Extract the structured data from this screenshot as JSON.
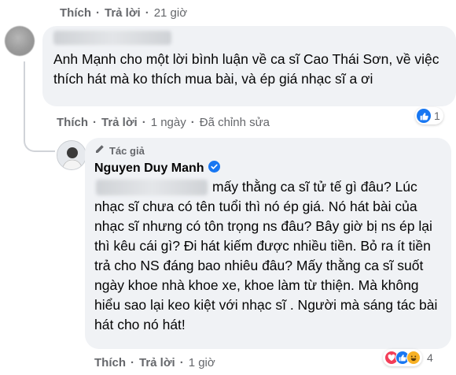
{
  "top_actions": {
    "like": "Thích",
    "reply": "Trả lời",
    "time": "21 giờ"
  },
  "comment_1": {
    "text": "Anh Mạnh cho một lời bình luận về ca sĩ Cao Thái Sơn, về việc thích hát mà ko thích mua bài, và ép giá nhạc sĩ a ơi",
    "actions": {
      "like": "Thích",
      "reply": "Trả lời",
      "time": "1 ngày",
      "edited": "Đã chỉnh sửa"
    },
    "reactions": {
      "icons": [
        "like-icon"
      ],
      "count": "1"
    }
  },
  "reply_1": {
    "author_badge": "Tác giả",
    "author_name": "Nguyen Duy Manh",
    "text": "mấy thằng ca sĩ tử tế gì đâu? Lúc nhạc sĩ chưa có tên tuổi thì nó ép giá. Nó hát bài của nhạc sĩ nhưng có tôn trọng ns đâu? Bây giờ bị ns ép lại thì kêu cái gì? Đi hát kiếm được nhiều tiền. Bỏ ra ít tiền trả cho NS đáng bao nhiêu đâu? Mấy thằng ca sĩ suốt ngày khoe nhà khoe xe, khoe làm từ thiện. Mà không hiểu sao lại keo kiệt với nhạc sĩ . Người mà sáng tác bài hát cho nó hát!",
    "actions": {
      "like": "Thích",
      "reply": "Trả lời",
      "time": "1 giờ"
    },
    "reactions": {
      "icons": [
        "love-icon",
        "like-icon",
        "haha-icon"
      ],
      "count": "4"
    }
  },
  "colors": {
    "bubble": "#f0f2f5",
    "secondary_text": "#65676b",
    "verified": "#1877f2",
    "like": "#1877f2",
    "love": "#f33e58",
    "haha": "#f7b125"
  }
}
